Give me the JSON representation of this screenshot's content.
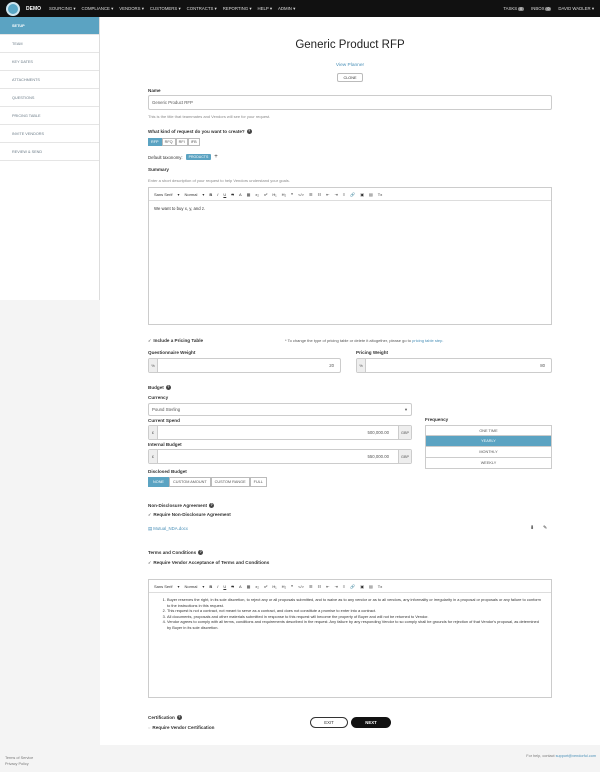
{
  "topbar": {
    "brand": "DEMO",
    "nav": [
      "SOURCING ▾",
      "COMPLIANCE ▾",
      "VENDORS ▾",
      "CUSTOMERS ▾",
      "CONTRACTS ▾",
      "REPORTING ▾",
      "HELP ▾",
      "ADMIN ▾"
    ],
    "tasks_label": "TASKS",
    "tasks_count": "0",
    "inbox_label": "INBOX",
    "inbox_count": "0",
    "user": "DAVID WADLER ▾"
  },
  "sidebar": {
    "items": [
      "SETUP",
      "TEAM",
      "KEY DATES",
      "ATTACHMENTS",
      "QUESTIONS",
      "PRICING TABLE",
      "INVITE VENDORS",
      "REVIEW & SEND"
    ]
  },
  "main": {
    "title": "Generic Product RFP",
    "view_planner": "View Planner",
    "clone": "CLONE",
    "name_label": "Name",
    "name_value": "Generic Product RFP",
    "name_hint": "This is the title that teammates and Vendors will see for your request.",
    "kind_label": "What kind of request do you want to create?",
    "kinds": [
      "RFP",
      "RFQ",
      "RFI",
      "IFB"
    ],
    "taxonomy_label": "Default taxonomy:",
    "taxonomy_tag": "PRODUCTS",
    "summary_label": "Summary",
    "summary_hint": "Enter a short description of your request to help Vendors understand your goals.",
    "toolbar": {
      "font": "Sans Serif",
      "size": "Normal",
      "tools": [
        "B",
        "I",
        "U",
        "S",
        "A",
        "▦",
        "x₂",
        "x²",
        "H₁",
        "H₂",
        "❝",
        "</>",
        "☰",
        "☷",
        "⇤",
        "⇥",
        "≡",
        "🔗",
        "▣",
        "▤",
        "Tx"
      ]
    },
    "summary_text": "We want to buy x, y, and z.",
    "pricing_check": "Include a Pricing Table",
    "pricing_note": "* To change the type of pricing table or delete it altogether, please go to",
    "pricing_link": "pricing table step.",
    "q_weight_label": "Questionnaire Weight",
    "q_weight_value": "20",
    "p_weight_label": "Pricing Weight",
    "p_weight_value": "80",
    "percent": "%",
    "budget_label": "Budget",
    "currency_label": "Currency",
    "currency_value": "Pound Sterling",
    "current_spend_label": "Current Spend",
    "current_spend_value": "500,000.00",
    "internal_budget_label": "Internal Budget",
    "internal_budget_value": "550,000.00",
    "currency_symbol": "£",
    "currency_code": "GBP",
    "frequency_label": "Frequency",
    "frequency": [
      "ONE TIME",
      "YEARLY",
      "MONTHLY",
      "WEEKLY"
    ],
    "disclosed_label": "Disclosed Budget",
    "disclosed": [
      "NONE",
      "CUSTOM AMOUNT",
      "CUSTOM RANGE",
      "FULL"
    ],
    "nda_label": "Non-Disclosure Agreement",
    "nda_check": "Require Non-Disclosure Agreement",
    "nda_file": "Mutual_NDA.docx",
    "terms_label": "Terms and Conditions",
    "terms_check": "Require Vendor Acceptance of Terms and Conditions",
    "terms_items": [
      "Buyer reserves the right, in its sole discretion, to reject any or all proposals submitted, and to waive as to any vendor or as to all vendors, any informality or irregularity in a proposal or proposals or any failure to conform to the instructions in this request.",
      "This request is not a contract, not meant to serve as a contract, and does not constitute a promise to enter into a contract.",
      "All documents, proposals and other materials submitted in response to this request will become the property of Buyer and will not be returned to Vendor.",
      "Vendor agrees to comply with all terms, conditions and requirements described in the request. Any failure by any responding Vendor to so comply shall be grounds for rejection of that Vendor's proposal, as determined by Buyer in its sole discretion."
    ],
    "cert_label": "Certification",
    "cert_check": "Require Vendor Certification",
    "exit": "EXIT",
    "next": "NEXT"
  },
  "footer": {
    "terms": "Terms of Service",
    "privacy": "Privacy Policy",
    "help": "For help, contact",
    "email": "support@vendorful.com"
  }
}
